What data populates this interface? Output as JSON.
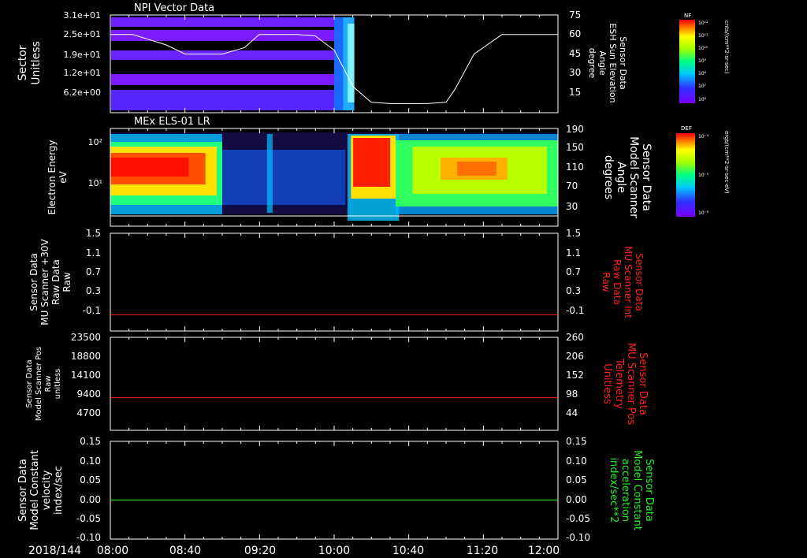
{
  "figure": {
    "date_label": "2018/144",
    "time_ticks": [
      "08:00",
      "08:40",
      "09:20",
      "10:00",
      "10:40",
      "11:20",
      "12:00"
    ]
  },
  "colors": {
    "red": "#ff2020",
    "green": "#22ee22",
    "white": "#ffffff",
    "frame": "#ffffff"
  },
  "chart_data": [
    {
      "type": "heatmap",
      "title": "NPI Vector Data",
      "ylabel_left": [
        "Sector",
        "Unitless"
      ],
      "ylabel_right": [
        "Sensor Data",
        "ESH Sun Elevation",
        "Angle",
        "degree"
      ],
      "yticks_left": [
        "3.1e+01",
        "2.5e+01",
        "1.9e+01",
        "1.2e+01",
        "6.2e+00"
      ],
      "yticks_right": [
        "75",
        "60",
        "45",
        "30",
        "15"
      ],
      "ylim_right": [
        0,
        75
      ],
      "colorbar": {
        "label": "NF",
        "units": "cnts/(cm**2-sr-sec)",
        "ticks": [
          "10¹²",
          "10¹¹",
          "10¹⁰",
          "10⁹",
          "10⁸",
          "10⁷",
          "10⁶"
        ]
      },
      "series": [
        {
          "name": "Sensor Data ESH Sun Elevation Angle",
          "line_color": "#ffffff",
          "x_hours": [
            8.0,
            8.2,
            8.5,
            8.67,
            9.0,
            9.2,
            9.33,
            9.5,
            9.67,
            9.83,
            10.0,
            10.17,
            10.33,
            10.5,
            10.83,
            11.0,
            11.08,
            11.25,
            11.5,
            12.0
          ],
          "values": [
            60,
            60,
            52,
            45,
            45,
            50,
            60,
            60,
            60,
            59,
            48,
            20,
            8,
            7,
            7,
            8,
            18,
            45,
            60,
            60
          ]
        }
      ]
    },
    {
      "type": "heatmap",
      "title": "MEx ELS-01 LR",
      "ylabel_left": [
        "Electron Energy",
        "eV"
      ],
      "ylabel_right": [
        "Sensor Data",
        "Model Scanner",
        "Angle",
        "degrees"
      ],
      "yticks_left": [
        "10²",
        "10¹"
      ],
      "yticks_right": [
        "190",
        "150",
        "110",
        "70",
        "30"
      ],
      "ylim_right": [
        0,
        190
      ],
      "colorbar": {
        "label": "DEF",
        "units": "ergs/(cm**2-sr-sec-eV)",
        "ticks": [
          "10⁻⁴",
          "10⁻⁵",
          "10⁻⁶"
        ]
      },
      "series": [
        {
          "name": "Sensor Data Model Scanner Angle",
          "line_color": "#ffffff",
          "x_hours": [
            8.0,
            12.0
          ],
          "values": [
            10,
            10
          ]
        }
      ]
    },
    {
      "type": "line",
      "ylabel_left": [
        "Sensor Data",
        "MU Scanner +30V",
        "Raw Data",
        "Raw"
      ],
      "ylabel_right": [
        "Sensor Data",
        "MU Scanner Int",
        "Raw Data",
        "Raw"
      ],
      "yticks_left": [
        "1.5",
        "1.1",
        "0.7",
        "0.3",
        "-0.1"
      ],
      "yticks_right": [
        "1.5",
        "1.1",
        "0.7",
        "0.3",
        "-0.1"
      ],
      "ylim": [
        -0.3,
        1.5
      ],
      "series": [
        {
          "name": "Sensor Data MU Scanner Int Raw Data",
          "color": "#ff2020",
          "x_hours": [
            8.0,
            12.0
          ],
          "values": [
            0.0,
            0.0
          ]
        }
      ]
    },
    {
      "type": "line",
      "ylabel_left": [
        "Sensor Data",
        "Model Scanner Pos",
        "Raw",
        "unitless"
      ],
      "ylabel_right": [
        "Sensor Data",
        "MU Scanner Pos",
        "Telemetry",
        "Unitless"
      ],
      "yticks_left": [
        "23500",
        "18800",
        "14100",
        "9400",
        "4700"
      ],
      "yticks_right": [
        "260",
        "206",
        "152",
        "98",
        "44"
      ],
      "ylim_left": [
        0,
        23500
      ],
      "ylim_right": [
        0,
        260
      ],
      "series": [
        {
          "name": "Sensor Data Model Scanner Pos Raw",
          "color": "#ff2020",
          "x_hours": [
            8.0,
            12.0
          ],
          "values": [
            8300,
            8300
          ]
        }
      ]
    },
    {
      "type": "line",
      "ylabel_left": [
        "Sensor Data",
        "Model Constant",
        "velocity",
        "index/sec"
      ],
      "ylabel_right": [
        "Sensor Data",
        "Model Constant",
        "acceleration",
        "index/sec**2"
      ],
      "yticks_left": [
        "0.15",
        "0.10",
        "0.05",
        "0.00",
        "-0.05",
        "-0.10"
      ],
      "yticks_right": [
        "0.15",
        "0.10",
        "0.05",
        "0.00",
        "-0.05",
        "-0.10"
      ],
      "ylim": [
        -0.1,
        0.15
      ],
      "series": [
        {
          "name": "Sensor Data Model Constant acceleration",
          "color": "#22ee22",
          "x_hours": [
            8.0,
            12.0
          ],
          "values": [
            0.0,
            0.0
          ]
        }
      ]
    }
  ]
}
